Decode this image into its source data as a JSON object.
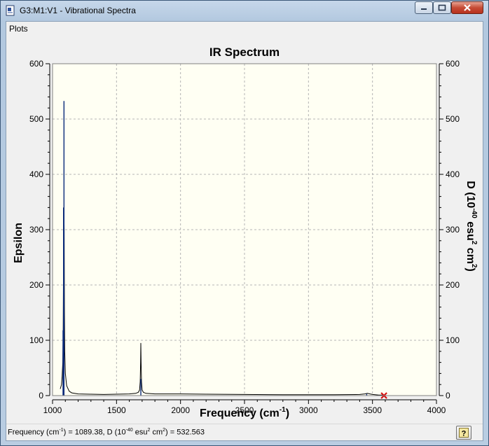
{
  "window": {
    "title": "G3:M1:V1 - Vibrational Spectra"
  },
  "menu": {
    "items": [
      "Plots"
    ]
  },
  "status": {
    "prefix": "Frequency (cm",
    "sup1": "-1",
    "middle1": ") = 1089.38, D (10",
    "sup2": "-40",
    "middle2": " esu",
    "sup3": "2",
    "middle3": " cm",
    "sup4": "2",
    "suffix": ") = 532.563"
  },
  "icons": {
    "app": "gaussview-doc-icon",
    "help": "help-question-icon"
  },
  "colors": {
    "plot_background": "#fffff3",
    "spectrum_line": "#000000",
    "stick_color": "#0a2a7a",
    "marker_color": "#d81010"
  },
  "chart_data": {
    "type": "line",
    "title": "IR Spectrum",
    "xlabel": "Frequency (cm-1)",
    "xlabel_base": "Frequency (cm",
    "xlabel_sup": "-1",
    "xlabel_end": ")",
    "ylabel": "Epsilon",
    "y2label": "D (10-40 esu2 cm2)",
    "y2label_parts": {
      "a": "D (10",
      "b": "-40",
      "c": " esu",
      "d": "2",
      "e": " cm",
      "f": "2",
      "g": ")"
    },
    "xlim": [
      1000,
      4000
    ],
    "ylim": [
      0,
      600
    ],
    "y2lim": [
      0,
      600
    ],
    "xticks": [
      1000,
      1500,
      2000,
      2500,
      3000,
      3500,
      4000
    ],
    "yticks": [
      0,
      100,
      200,
      300,
      400,
      500,
      600
    ],
    "grid": true,
    "series": [
      {
        "x": [
          1060,
          1070,
          1075,
          1080,
          1083,
          1086,
          1088,
          1089.4,
          1091,
          1093,
          1095,
          1100,
          1110,
          1130,
          1150,
          1200,
          1300,
          1400,
          1500,
          1600,
          1650,
          1670,
          1680,
          1685,
          1688,
          1690,
          1692,
          1695,
          1700,
          1710,
          1730,
          1800,
          2000,
          2200,
          2500,
          2800,
          3000,
          3200,
          3400,
          3440,
          3460,
          3480,
          3500,
          3550,
          3600
        ],
        "y": [
          12,
          20,
          35,
          60,
          120,
          260,
          330,
          332,
          300,
          150,
          80,
          40,
          18,
          8,
          5,
          3,
          2.5,
          2,
          2.5,
          3,
          4,
          6,
          10,
          25,
          60,
          95,
          60,
          25,
          10,
          6,
          4,
          3,
          3,
          2.5,
          2,
          1.5,
          1.5,
          1.5,
          2,
          3,
          4,
          3,
          2,
          1,
          1
        ]
      }
    ],
    "sticks": [
      {
        "x": 1082,
        "d": 118
      },
      {
        "x": 1086,
        "d": 340
      },
      {
        "x": 1089.38,
        "d": 532.563
      },
      {
        "x": 1690,
        "d": 30
      },
      {
        "x": 3455,
        "d": 3
      },
      {
        "x": 3590,
        "d": 2
      }
    ],
    "selected_marker": {
      "x": 3590,
      "y": 0
    }
  }
}
